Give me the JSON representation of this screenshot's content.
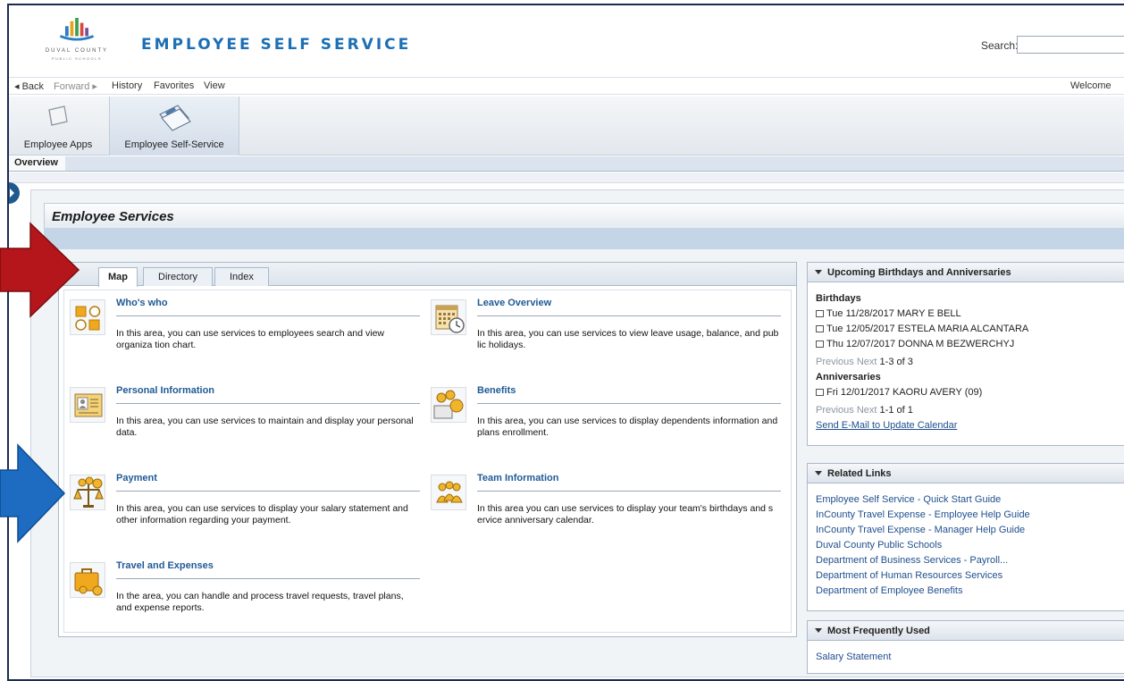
{
  "header": {
    "logo_line1": "DUVAL COUNTY",
    "logo_line2": "PUBLIC SCHOOLS",
    "title": "EMPLOYEE SELF SERVICE",
    "search_label": "Search:",
    "search_value": ""
  },
  "navbar": {
    "back": "◂ Back",
    "forward": "Forward ▸",
    "history": "History",
    "favorites": "Favorites",
    "view": "View",
    "welcome": "Welcome"
  },
  "top_tabs": [
    {
      "label": "Employee Apps",
      "icon": "folder-icon",
      "selected": false
    },
    {
      "label": "Employee Self-Service",
      "icon": "documents-icon",
      "selected": true
    }
  ],
  "second_level": {
    "overview": "Overview"
  },
  "page": {
    "title": "Employee Services"
  },
  "map_tabs": [
    "Map",
    "Directory",
    "Index"
  ],
  "services": [
    {
      "title": "Who's who",
      "desc": "In this area, you can use services to employees search and view organiza tion chart.",
      "icon": "org-squares-icon"
    },
    {
      "title": "Leave Overview",
      "desc": "In this area, you can use services to view leave usage, balance, and pub lic holidays.",
      "icon": "calendar-clock-icon"
    },
    {
      "title": "Personal Information",
      "desc": "In this area, you can use services to maintain and display your personal data.",
      "icon": "id-card-icon"
    },
    {
      "title": "Benefits",
      "desc": "In this area, you can use services to display dependents information and plans enrollment.",
      "icon": "coins-icon"
    },
    {
      "title": "Payment",
      "desc": "In this area, you can use services to display your salary statement and other information regarding your payment.",
      "icon": "scale-coins-icon"
    },
    {
      "title": "Team Information",
      "desc": "In this area you can use services to display your team's birthdays and s ervice anniversary calendar.",
      "icon": "team-icon"
    },
    {
      "title": "Travel and Expenses",
      "desc": "In the area, you can handle and process travel requests, travel plans, and expense reports.",
      "icon": "suitcase-icon"
    }
  ],
  "birthdays_panel": {
    "title": "Upcoming Birthdays and Anniversaries",
    "birthdays_label": "Birthdays",
    "birthdays": [
      "Tue 11/28/2017  MARY E BELL",
      "Tue 12/05/2017  ESTELA MARIA ALCANTARA",
      "Thu 12/07/2017  DONNA M BEZWERCHYJ"
    ],
    "birthdays_pager_prev": "Previous",
    "birthdays_pager_next": "Next",
    "birthdays_pager_count": "1-3 of 3",
    "anniversaries_label": "Anniversaries",
    "anniversaries": [
      "Fri 12/01/2017  KAORU AVERY (09)"
    ],
    "anniv_pager_prev": "Previous",
    "anniv_pager_next": "Next",
    "anniv_pager_count": "1-1 of 1",
    "email_link": "Send E-Mail to Update Calendar"
  },
  "related_links": {
    "title": "Related Links",
    "links": [
      "Employee Self Service - Quick Start Guide",
      "InCounty Travel Expense - Employee Help Guide",
      "InCounty Travel Expense - Manager Help Guide",
      "Duval County Public Schools",
      "Department of Business Services - Payroll...",
      "Department of Human Resources Services",
      "Department of Employee Benefits"
    ]
  },
  "most_used": {
    "title": "Most Frequently Used",
    "links": [
      "Salary Statement"
    ]
  },
  "colors": {
    "brand_blue": "#1c6fb5",
    "link_blue": "#1f5a96",
    "red_arrow": "#b5161b",
    "blue_arrow": "#1d6cc1"
  }
}
